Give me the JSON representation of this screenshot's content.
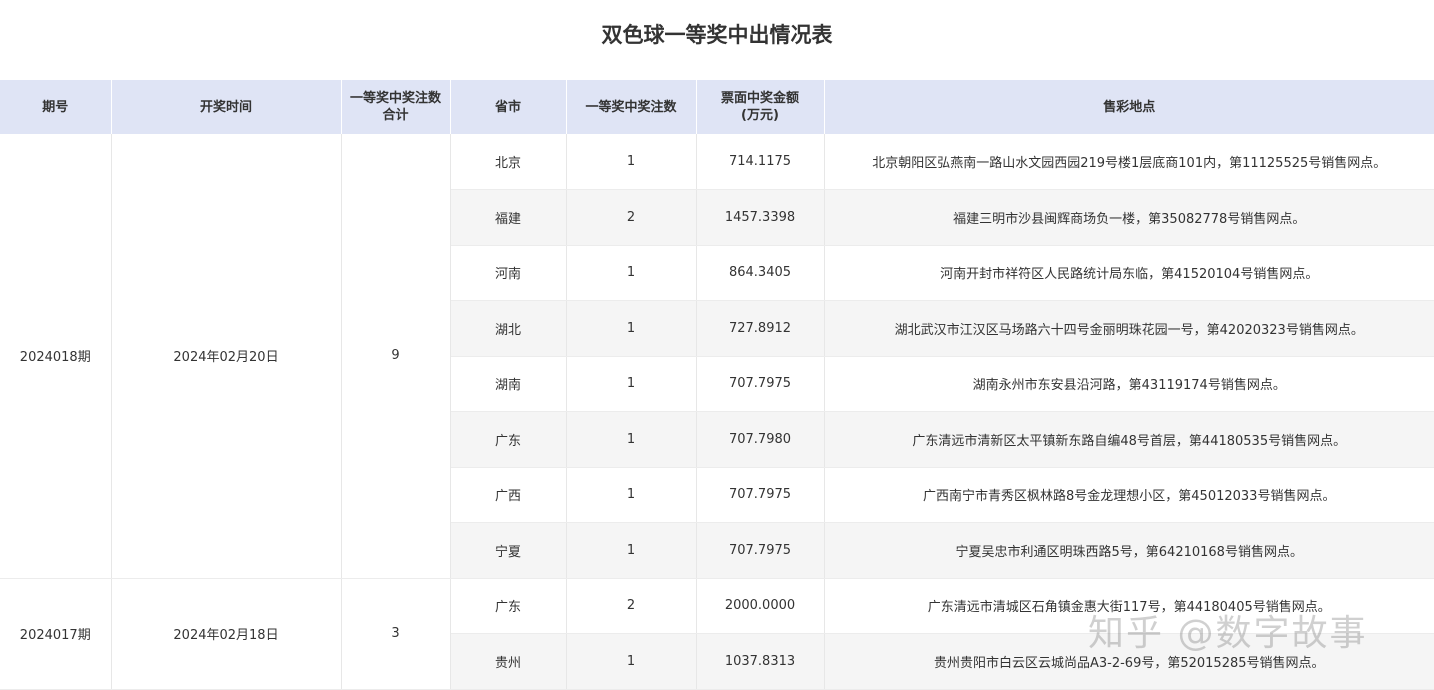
{
  "title": "双色球一等奖中出情况表",
  "columns": [
    "期号",
    "开奖时间",
    "一等奖中奖注数合计",
    "省市",
    "一等奖中奖注数",
    "票面中奖金额(万元)",
    "售彩地点"
  ],
  "column_headers": {
    "period": "期号",
    "draw_date": "开奖时间",
    "total_line1": "一等奖中奖注数",
    "total_line2": "合计",
    "province": "省市",
    "count": "一等奖中奖注数",
    "amount_line1": "票面中奖金额",
    "amount_line2": "(万元)",
    "location": "售彩地点"
  },
  "groups": [
    {
      "period": "2024018期",
      "draw_date": "2024年02月20日",
      "total": "9",
      "rows": [
        {
          "province": "北京",
          "count": "1",
          "amount": "714.1175",
          "location": "北京朝阳区弘燕南一路山水文园西园219号楼1层底商101内，第11125525号销售网点。"
        },
        {
          "province": "福建",
          "count": "2",
          "amount": "1457.3398",
          "location": "福建三明市沙县闽辉商场负一楼，第35082778号销售网点。"
        },
        {
          "province": "河南",
          "count": "1",
          "amount": "864.3405",
          "location": "河南开封市祥符区人民路统计局东临，第41520104号销售网点。"
        },
        {
          "province": "湖北",
          "count": "1",
          "amount": "727.8912",
          "location": "湖北武汉市江汉区马场路六十四号金丽明珠花园一号，第42020323号销售网点。"
        },
        {
          "province": "湖南",
          "count": "1",
          "amount": "707.7975",
          "location": "湖南永州市东安县沿河路，第43119174号销售网点。"
        },
        {
          "province": "广东",
          "count": "1",
          "amount": "707.7980",
          "location": "广东清远市清新区太平镇新东路自编48号首层，第44180535号销售网点。"
        },
        {
          "province": "广西",
          "count": "1",
          "amount": "707.7975",
          "location": "广西南宁市青秀区枫林路8号金龙理想小区，第45012033号销售网点。"
        },
        {
          "province": "宁夏",
          "count": "1",
          "amount": "707.7975",
          "location": "宁夏吴忠市利通区明珠西路5号，第64210168号销售网点。"
        }
      ]
    },
    {
      "period": "2024017期",
      "draw_date": "2024年02月18日",
      "total": "3",
      "rows": [
        {
          "province": "广东",
          "count": "2",
          "amount": "2000.0000",
          "location": "广东清远市清城区石角镇金惠大街117号，第44180405号销售网点。"
        },
        {
          "province": "贵州",
          "count": "1",
          "amount": "1037.8313",
          "location": "贵州贵阳市白云区云城尚品A3-2-69号，第52015285号销售网点。"
        }
      ]
    }
  ],
  "watermark": "知乎 @数字故事"
}
